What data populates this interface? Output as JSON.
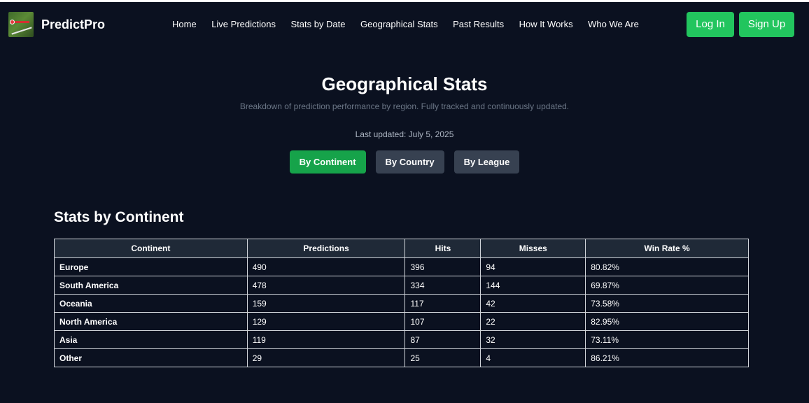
{
  "header": {
    "brand": "PredictPro",
    "nav": [
      "Home",
      "Live Predictions",
      "Stats by Date",
      "Geographical Stats",
      "Past Results",
      "How It Works",
      "Who We Are"
    ],
    "login_label": "Log In",
    "signup_label": "Sign Up"
  },
  "main": {
    "title": "Geographical Stats",
    "subtitle": "Breakdown of prediction performance by region. Fully tracked and continuously updated.",
    "last_updated": "Last updated: July 5, 2025",
    "tabs": [
      {
        "label": "By Continent",
        "active": true
      },
      {
        "label": "By Country",
        "active": false
      },
      {
        "label": "By League",
        "active": false
      }
    ],
    "section_title": "Stats by Continent"
  },
  "table": {
    "headers": [
      "Continent",
      "Predictions",
      "Hits",
      "Misses",
      "Win Rate %"
    ],
    "rows": [
      [
        "Europe",
        "490",
        "396",
        "94",
        "80.82%"
      ],
      [
        "South America",
        "478",
        "334",
        "144",
        "69.87%"
      ],
      [
        "Oceania",
        "159",
        "117",
        "42",
        "73.58%"
      ],
      [
        "North America",
        "129",
        "107",
        "22",
        "82.95%"
      ],
      [
        "Asia",
        "119",
        "87",
        "32",
        "73.11%"
      ],
      [
        "Other",
        "29",
        "25",
        "4",
        "86.21%"
      ]
    ]
  },
  "colors": {
    "background": "#0b1120",
    "accent": "#22c55e",
    "active_tab": "#16a34a",
    "inactive_tab": "#374151"
  }
}
